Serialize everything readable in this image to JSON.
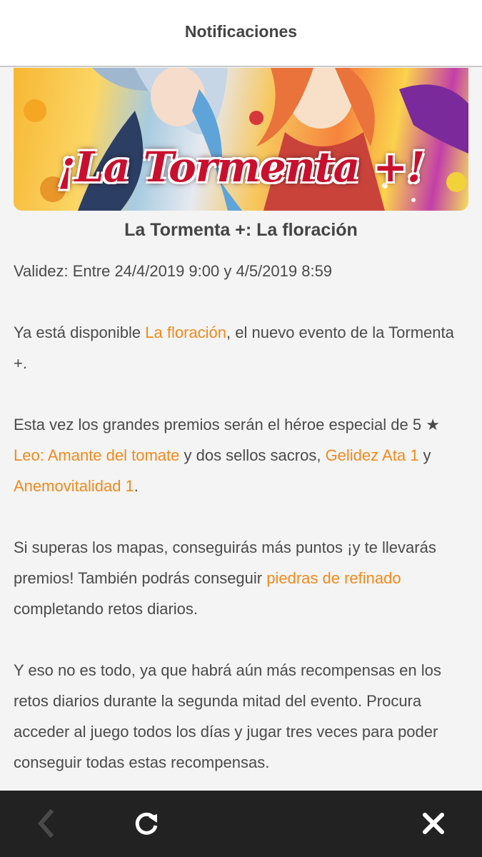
{
  "header": {
    "title": "Notificaciones"
  },
  "banner": {
    "text": "¡La Tormenta +!"
  },
  "article": {
    "title": "La Tormenta +: La floración",
    "validity": "Validez: Entre 24/4/2019 9:00 y 4/5/2019 8:59",
    "p1": {
      "t1": "Ya está disponible ",
      "link1": "La floración",
      "t2": ", el nuevo evento de la Tormenta +."
    },
    "p2": {
      "t1": "Esta vez los grandes premios serán el héroe especial de 5 ★ ",
      "link1": "Leo: Amante del tomate",
      "t2": " y dos sellos sacros, ",
      "link2": "Gelidez Ata 1",
      "t3": " y ",
      "link3": "Anemovitalidad 1",
      "t4": "."
    },
    "p3": {
      "t1": "Si superas los mapas, conseguirás más puntos ¡y te llevarás premios! También podrás conseguir ",
      "link1": "piedras de refinado",
      "t2": " completando retos diarios."
    },
    "p4": {
      "t1": "Y eso no es todo, ya que habrá aún más recompensas en los retos diarios durante la segunda mitad del evento. Procura acceder al juego todos los días y jugar tres veces para poder conseguir todas estas recompensas."
    }
  },
  "footer": {
    "back_icon": "chevron-left-icon",
    "refresh_icon": "refresh-icon",
    "close_icon": "close-icon"
  },
  "colors": {
    "link": "#f08a1c",
    "text": "#4a4a4a",
    "footer_bg": "#222222"
  }
}
